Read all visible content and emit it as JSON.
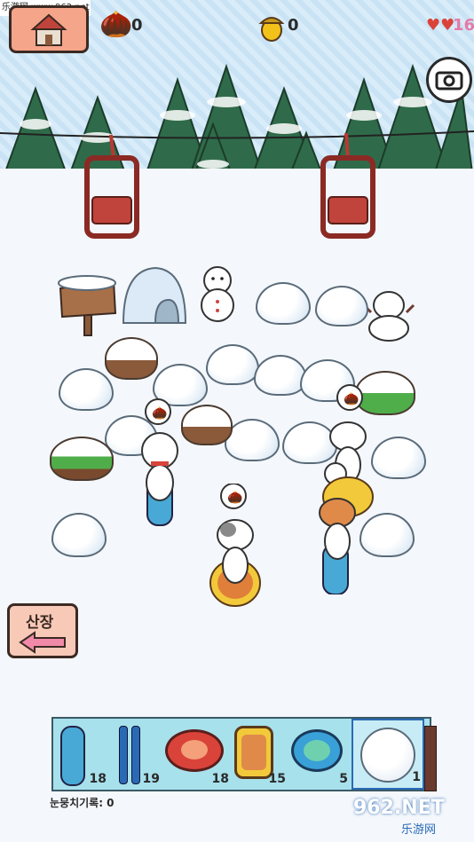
{
  "watermark": {
    "site": "乐游网 www.962.net",
    "logo_main": "962.NET",
    "logo_sub": "乐游网"
  },
  "topbar": {
    "acorn_brown_count": "0",
    "acorn_gold_count": "0",
    "hearts_count": "16"
  },
  "back_button": {
    "label": "산장"
  },
  "toolbar": {
    "slots": [
      {
        "name": "blue-sled",
        "count": "18"
      },
      {
        "name": "blue-skis",
        "count": "19"
      },
      {
        "name": "red-tube",
        "count": "18"
      },
      {
        "name": "wooden-sled",
        "count": "15"
      },
      {
        "name": "green-tube",
        "count": "5"
      },
      {
        "name": "snowball",
        "count": "1"
      }
    ],
    "record_label": "눈뭉치기록: 0"
  },
  "colors": {
    "toolbar_bg": "#a7e1ec",
    "home_btn": "#f5a58a",
    "accent_red": "#d9433a"
  },
  "icons": [
    "house-icon",
    "acorn-icon",
    "gold-acorn-icon",
    "hearts-icon",
    "camera-icon",
    "arrow-left-icon"
  ]
}
